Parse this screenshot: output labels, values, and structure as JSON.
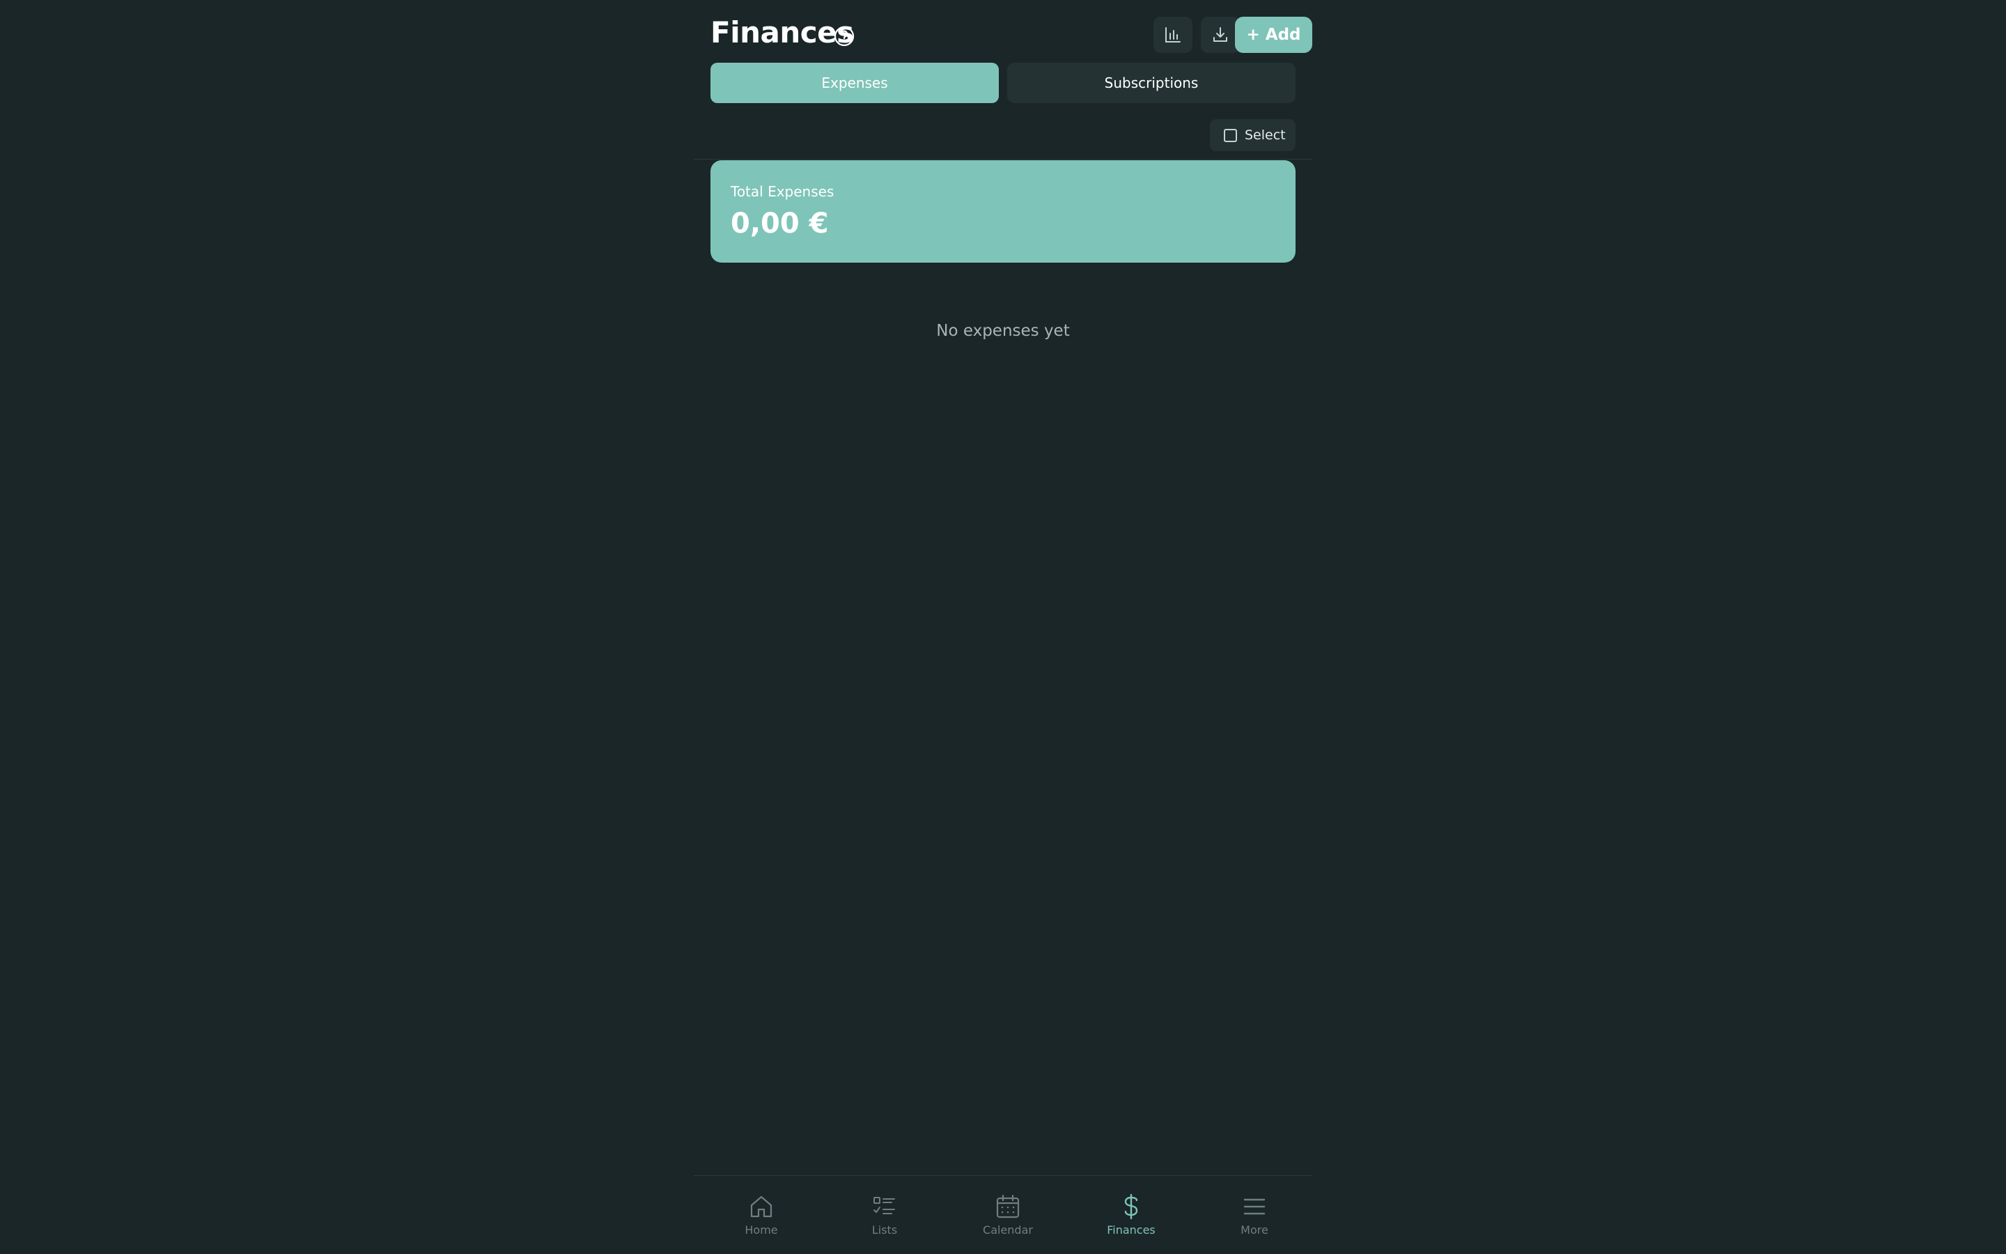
{
  "header": {
    "title": "Finances",
    "add_label": "+ Add"
  },
  "tabs": [
    {
      "label": "Expenses",
      "active": true
    },
    {
      "label": "Subscriptions",
      "active": false
    }
  ],
  "select": {
    "label": "Select"
  },
  "total": {
    "label": "Total Expenses",
    "value": "0,00 €"
  },
  "empty_state": "No expenses yet",
  "nav": {
    "items": [
      {
        "label": "Home",
        "icon": "home-icon",
        "active": false
      },
      {
        "label": "Lists",
        "icon": "list-icon",
        "active": false
      },
      {
        "label": "Calendar",
        "icon": "calendar-icon",
        "active": false
      },
      {
        "label": "Finances",
        "icon": "dollar-icon",
        "active": true
      },
      {
        "label": "More",
        "icon": "menu-icon",
        "active": false
      }
    ]
  },
  "colors": {
    "background": "#1a2627",
    "accent": "#7fc4b8",
    "surface": "#243234",
    "muted_text": "#6f7f80"
  }
}
